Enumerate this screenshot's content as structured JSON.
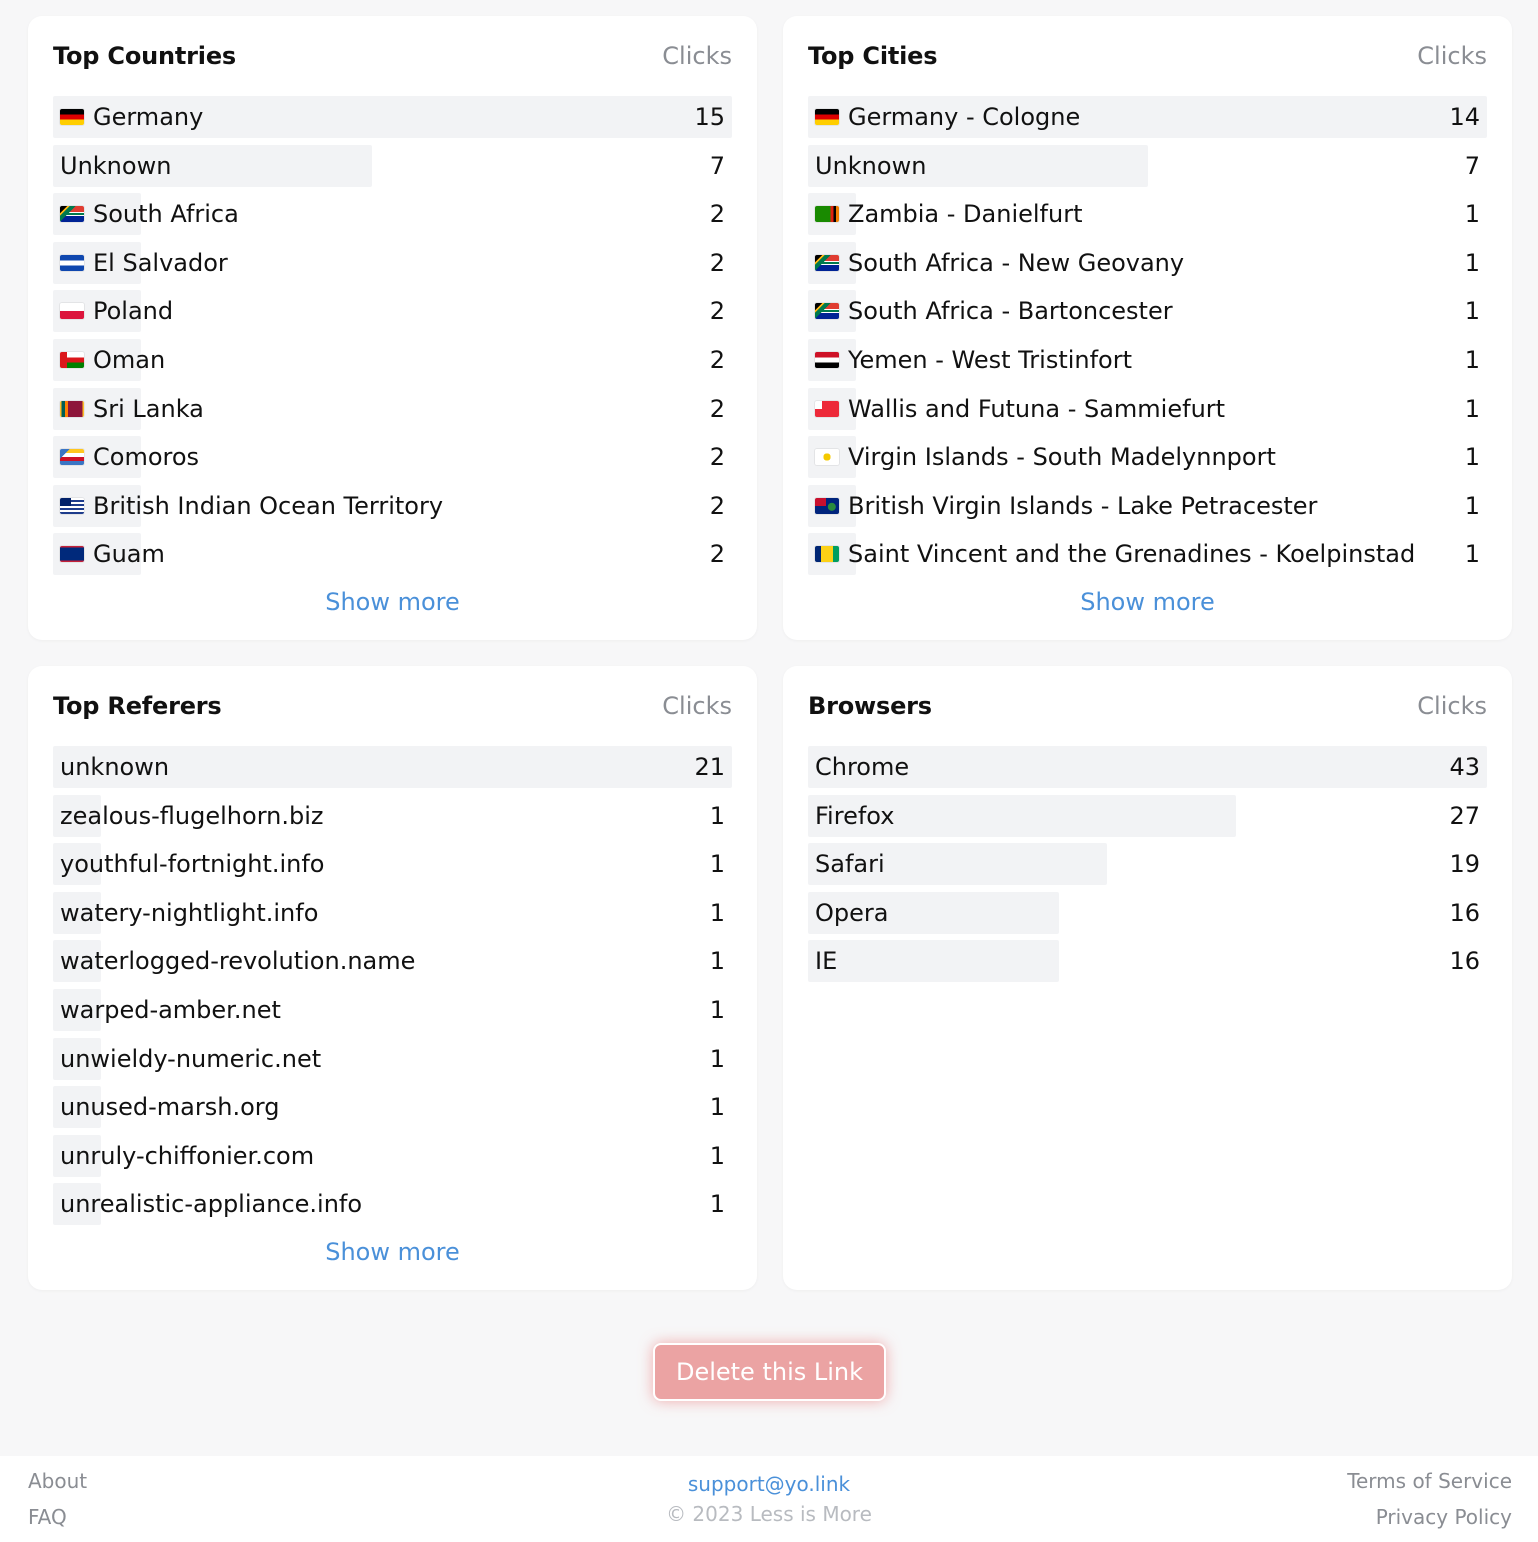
{
  "countries": {
    "title": "Top Countries",
    "col": "Clicks",
    "show_more": "Show more",
    "rows": [
      {
        "flag": "flag-germany-icon",
        "label": "Germany",
        "value": "15",
        "frac": 1.0
      },
      {
        "flag": "",
        "label": "Unknown",
        "value": "7",
        "frac": 0.47
      },
      {
        "flag": "flag-south-africa-icon",
        "label": "South Africa",
        "value": "2",
        "frac": 0.13
      },
      {
        "flag": "flag-el-salvador-icon",
        "label": "El Salvador",
        "value": "2",
        "frac": 0.13
      },
      {
        "flag": "flag-poland-icon",
        "label": "Poland",
        "value": "2",
        "frac": 0.13
      },
      {
        "flag": "flag-oman-icon",
        "label": "Oman",
        "value": "2",
        "frac": 0.13
      },
      {
        "flag": "flag-sri-lanka-icon",
        "label": "Sri Lanka",
        "value": "2",
        "frac": 0.13
      },
      {
        "flag": "flag-comoros-icon",
        "label": "Comoros",
        "value": "2",
        "frac": 0.13
      },
      {
        "flag": "flag-british-indian-ocean-territory-icon",
        "label": "British Indian Ocean Territory",
        "value": "2",
        "frac": 0.13
      },
      {
        "flag": "flag-guam-icon",
        "label": "Guam",
        "value": "2",
        "frac": 0.13
      }
    ]
  },
  "cities": {
    "title": "Top Cities",
    "col": "Clicks",
    "show_more": "Show more",
    "rows": [
      {
        "flag": "flag-germany-icon",
        "label": "Germany - Cologne",
        "value": "14",
        "frac": 1.0
      },
      {
        "flag": "",
        "label": "Unknown",
        "value": "7",
        "frac": 0.5
      },
      {
        "flag": "flag-zambia-icon",
        "label": "Zambia - Danielfurt",
        "value": "1",
        "frac": 0.07
      },
      {
        "flag": "flag-south-africa-icon",
        "label": "South Africa - New Geovany",
        "value": "1",
        "frac": 0.07
      },
      {
        "flag": "flag-south-africa-icon",
        "label": "South Africa - Bartoncester",
        "value": "1",
        "frac": 0.07
      },
      {
        "flag": "flag-yemen-icon",
        "label": "Yemen - West Tristinfort",
        "value": "1",
        "frac": 0.07
      },
      {
        "flag": "flag-wallis-and-futuna-icon",
        "label": "Wallis and Futuna - Sammiefurt",
        "value": "1",
        "frac": 0.07
      },
      {
        "flag": "flag-virgin-islands-icon",
        "label": "Virgin Islands - South Madelynnport",
        "value": "1",
        "frac": 0.07
      },
      {
        "flag": "flag-british-virgin-islands-icon",
        "label": "British Virgin Islands - Lake Petracester",
        "value": "1",
        "frac": 0.07
      },
      {
        "flag": "flag-saint-vincent-icon",
        "label": "Saint Vincent and the Grenadines - Koelpinstad",
        "value": "1",
        "frac": 0.07
      }
    ]
  },
  "referers": {
    "title": "Top Referers",
    "col": "Clicks",
    "show_more": "Show more",
    "rows": [
      {
        "flag": "",
        "label": "unknown",
        "value": "21",
        "frac": 1.0
      },
      {
        "flag": "",
        "label": "zealous-flugelhorn.biz",
        "value": "1",
        "frac": 0.05
      },
      {
        "flag": "",
        "label": "youthful-fortnight.info",
        "value": "1",
        "frac": 0.05
      },
      {
        "flag": "",
        "label": "watery-nightlight.info",
        "value": "1",
        "frac": 0.05
      },
      {
        "flag": "",
        "label": "waterlogged-revolution.name",
        "value": "1",
        "frac": 0.05
      },
      {
        "flag": "",
        "label": "warped-amber.net",
        "value": "1",
        "frac": 0.05
      },
      {
        "flag": "",
        "label": "unwieldy-numeric.net",
        "value": "1",
        "frac": 0.05
      },
      {
        "flag": "",
        "label": "unused-marsh.org",
        "value": "1",
        "frac": 0.05
      },
      {
        "flag": "",
        "label": "unruly-chiffonier.com",
        "value": "1",
        "frac": 0.05
      },
      {
        "flag": "",
        "label": "unrealistic-appliance.info",
        "value": "1",
        "frac": 0.05
      }
    ]
  },
  "browsers": {
    "title": "Browsers",
    "col": "Clicks",
    "rows": [
      {
        "flag": "",
        "label": "Chrome",
        "value": "43",
        "frac": 1.0
      },
      {
        "flag": "",
        "label": "Firefox",
        "value": "27",
        "frac": 0.63
      },
      {
        "flag": "",
        "label": "Safari",
        "value": "19",
        "frac": 0.44
      },
      {
        "flag": "",
        "label": "Opera",
        "value": "16",
        "frac": 0.37
      },
      {
        "flag": "",
        "label": "IE",
        "value": "16",
        "frac": 0.37
      }
    ]
  },
  "delete_label": "Delete this Link",
  "footer": {
    "about": "About",
    "faq": "FAQ",
    "email": "support@yo.link",
    "copyright": "© 2023 Less is More",
    "terms": "Terms of Service",
    "privacy": "Privacy Policy"
  },
  "colors": {
    "bar": "#f2f3f5",
    "link": "#4a90d9",
    "delete": "#eba3a3",
    "muted": "#8a8d93"
  }
}
